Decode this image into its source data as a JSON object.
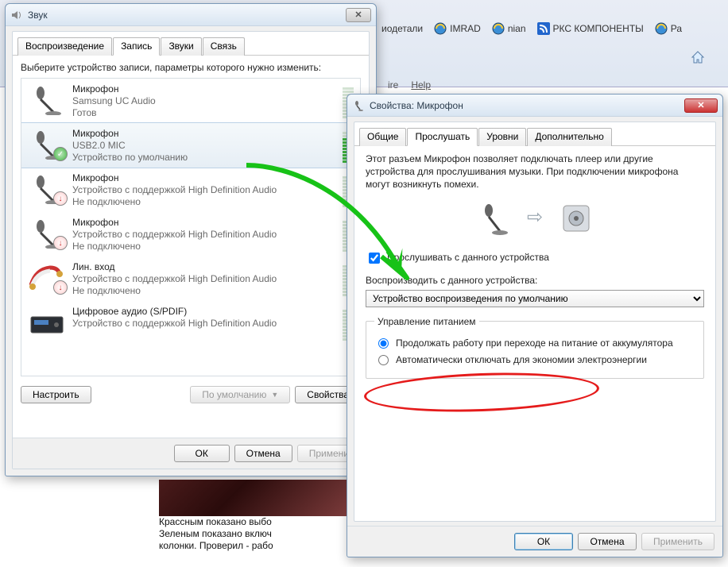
{
  "bookmarks": {
    "b1": "иодетали",
    "b2": "IMRAD",
    "b3": "nian",
    "b4": "РКС КОМПОНЕНТЫ",
    "b5": "Ра"
  },
  "menu": {
    "m1": "ire",
    "m2": "Help"
  },
  "sound": {
    "title": "Звук",
    "tabs": {
      "play": "Воспроизведение",
      "rec": "Запись",
      "sounds": "Звуки",
      "comm": "Связь"
    },
    "prompt": "Выберите устройство записи, параметры которого нужно изменить:",
    "devices": [
      {
        "name": "Микрофон",
        "sub": "Samsung UC Audio",
        "status": "Готов",
        "level": 0,
        "icon": "mic",
        "badge": ""
      },
      {
        "name": "Микрофон",
        "sub": "USB2.0 MIC",
        "status": "Устройство по умолчанию",
        "level": 8,
        "icon": "mic",
        "badge": "ok"
      },
      {
        "name": "Микрофон",
        "sub": "Устройство с поддержкой High Definition Audio",
        "status": "Не подключено",
        "level": 0,
        "icon": "mic",
        "badge": "err"
      },
      {
        "name": "Микрофон",
        "sub": "Устройство с поддержкой High Definition Audio",
        "status": "Не подключено",
        "level": 0,
        "icon": "mic",
        "badge": "err"
      },
      {
        "name": "Лин. вход",
        "sub": "Устройство с поддержкой High Definition Audio",
        "status": "Не подключено",
        "level": 0,
        "icon": "jack",
        "badge": "err"
      },
      {
        "name": "Цифровое аудио (S/PDIF)",
        "sub": "Устройство с поддержкой High Definition Audio",
        "status": "",
        "level": 0,
        "icon": "spdif",
        "badge": ""
      }
    ],
    "configure": "Настроить",
    "default": "По умолчанию",
    "properties": "Свойства",
    "ok": "ОК",
    "cancel": "Отмена",
    "apply": "Примени"
  },
  "prop": {
    "title": "Свойства: Микрофон",
    "tabs": {
      "general": "Общие",
      "listen": "Прослушать",
      "levels": "Уровни",
      "adv": "Дополнительно"
    },
    "desc": "Этот разъем Микрофон позволяет подключать плеер или другие устройства для прослушивания музыки. При подключении микрофона могут возникнуть помехи.",
    "listen_chk": "Прослушивать с данного устройства",
    "playback_lbl": "Воспроизводить с данного устройства:",
    "playback_sel": "Устройство воспроизведения по умолчанию",
    "pm_legend": "Управление питанием",
    "pm_r1": "Продолжать работу при переходе на питание от аккумулятора",
    "pm_r2": "Автоматически отключать для экономии электроэнергии",
    "ok": "ОК",
    "cancel": "Отмена",
    "apply": "Применить"
  },
  "annot": {
    "l1": "Крассным показано выбо",
    "l2": "Зеленым показано включ",
    "l3": "колонки. Проверил - рабо"
  }
}
